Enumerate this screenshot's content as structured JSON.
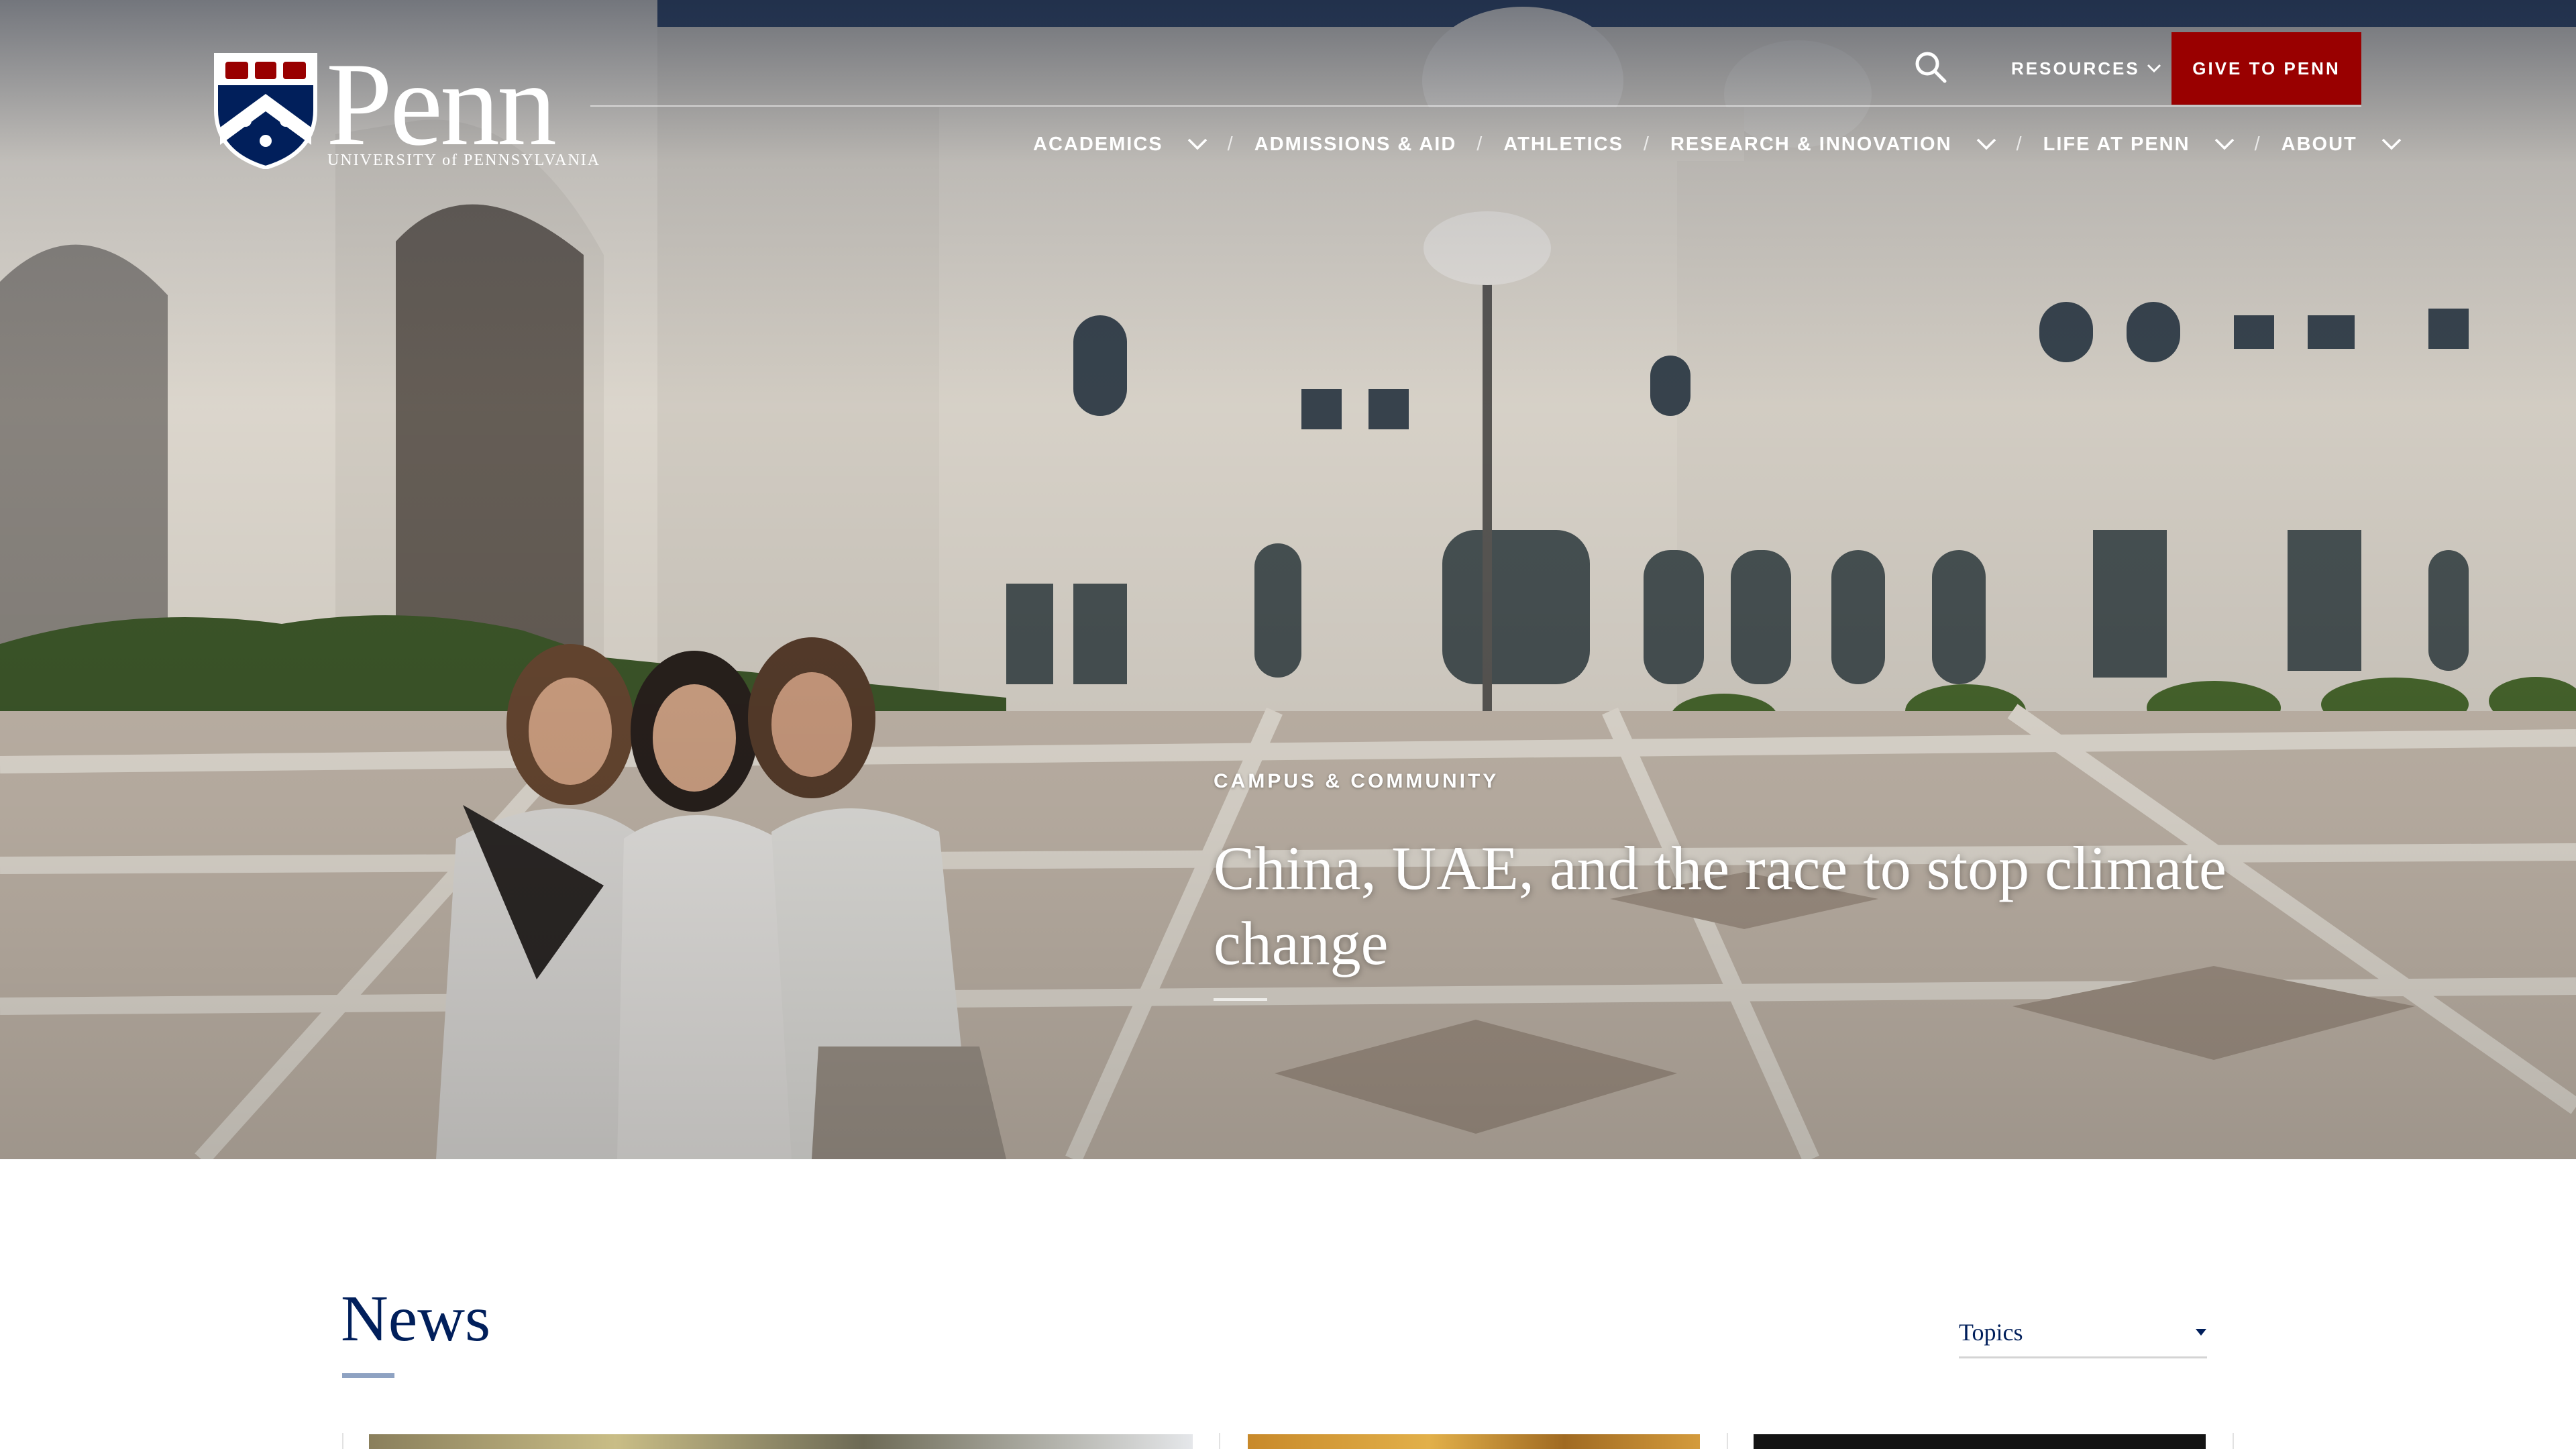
{
  "header": {
    "logo": {
      "wordmark": "Penn",
      "subtitle": "UNIVERSITY of PENNSYLVANIA"
    },
    "utility": {
      "resources_label": "RESOURCES",
      "give_label": "GIVE TO PENN"
    },
    "nav": [
      {
        "label": "ACADEMICS",
        "has_dropdown": true
      },
      {
        "label": "ADMISSIONS & AID",
        "has_dropdown": false
      },
      {
        "label": "ATHLETICS",
        "has_dropdown": false
      },
      {
        "label": "RESEARCH & INNOVATION",
        "has_dropdown": true
      },
      {
        "label": "LIFE AT PENN",
        "has_dropdown": true
      },
      {
        "label": "ABOUT",
        "has_dropdown": true
      }
    ],
    "nav_separator": "/"
  },
  "hero": {
    "category": "CAMPUS & COMMUNITY",
    "headline": "China, UAE, and the race to stop climate change"
  },
  "news": {
    "title": "News",
    "topics_label": "Topics"
  },
  "colors": {
    "penn_blue": "#011f5b",
    "penn_red": "#990000",
    "underline": "#8ea2c2"
  },
  "icons": [
    "penn-shield-icon",
    "search-icon",
    "chevron-down-icon",
    "caret-down-icon"
  ]
}
